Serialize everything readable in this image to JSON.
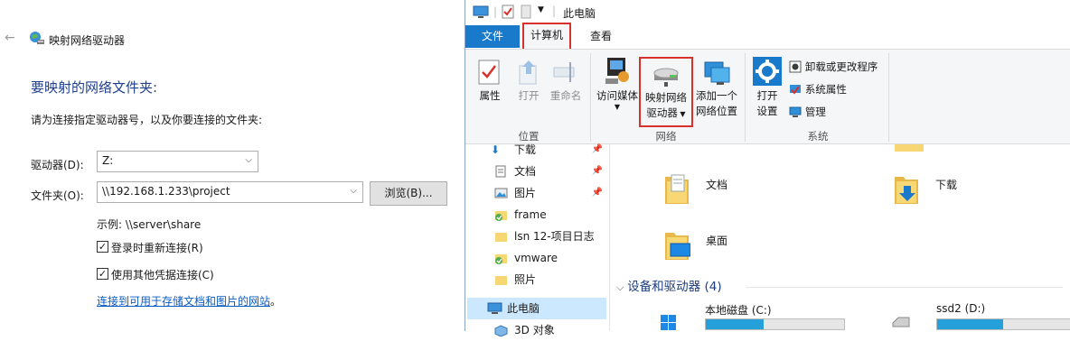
{
  "dialog": {
    "title": "映射网络驱动器",
    "heading": "要映射的网络文件夹:",
    "instruction": "请为连接指定驱动器号，以及你要连接的文件夹:",
    "drive_label": "驱动器(D):",
    "drive_value": "Z:",
    "folder_label": "文件夹(O):",
    "folder_value": "\\\\192.168.1.233\\project",
    "browse_label": "浏览(B)...",
    "example": "示例: \\\\server\\share",
    "reconnect_label": "登录时重新连接(R)",
    "reconnect_checked": true,
    "other_creds_label": "使用其他凭据连接(C)",
    "other_creds_checked": true,
    "link_text": "连接到可用于存储文档和图片的网站",
    "link_suffix": "。"
  },
  "explorer": {
    "title": "此电脑",
    "tabs": {
      "file": "文件",
      "computer": "计算机",
      "view": "查看"
    },
    "ribbon": {
      "location": {
        "properties": "属性",
        "open": "打开",
        "rename": "重命名",
        "group": "位置"
      },
      "network": {
        "access_media": "访问媒体",
        "map_drive_line1": "映射网络",
        "map_drive_line2": "驱动器",
        "add_location_line1": "添加一个",
        "add_location_line2": "网络位置",
        "group": "网络"
      },
      "system": {
        "open_settings_line1": "打开",
        "open_settings_line2": "设置",
        "uninstall": "卸载或更改程序",
        "system_properties": "系统属性",
        "manage": "管理",
        "group": "系统"
      }
    },
    "nav": [
      {
        "label": "下载",
        "pinned": true
      },
      {
        "label": "文档",
        "pinned": true
      },
      {
        "label": "图片",
        "pinned": true
      },
      {
        "label": "frame",
        "pinned": false
      },
      {
        "label": "lsn 12-项目日志",
        "pinned": false
      },
      {
        "label": "vmware",
        "pinned": false
      },
      {
        "label": "照片",
        "pinned": false
      },
      {
        "label": "此电脑",
        "pinned": false,
        "selected": true
      },
      {
        "label": "3D 对象",
        "pinned": false
      }
    ],
    "folders": {
      "documents": "文档",
      "downloads": "下载",
      "desktop": "桌面"
    },
    "devices_section": "设备和驱动器 (4)",
    "drives": [
      {
        "name": "本地磁盘 (C:)",
        "used_fraction": 0.42
      },
      {
        "name": "ssd2 (D:)",
        "used_fraction": 0.48
      }
    ]
  },
  "colors": {
    "accent": "#1979ca",
    "highlight": "#d9302b",
    "heading": "#1f3f8f",
    "link": "#0a5cc2"
  }
}
